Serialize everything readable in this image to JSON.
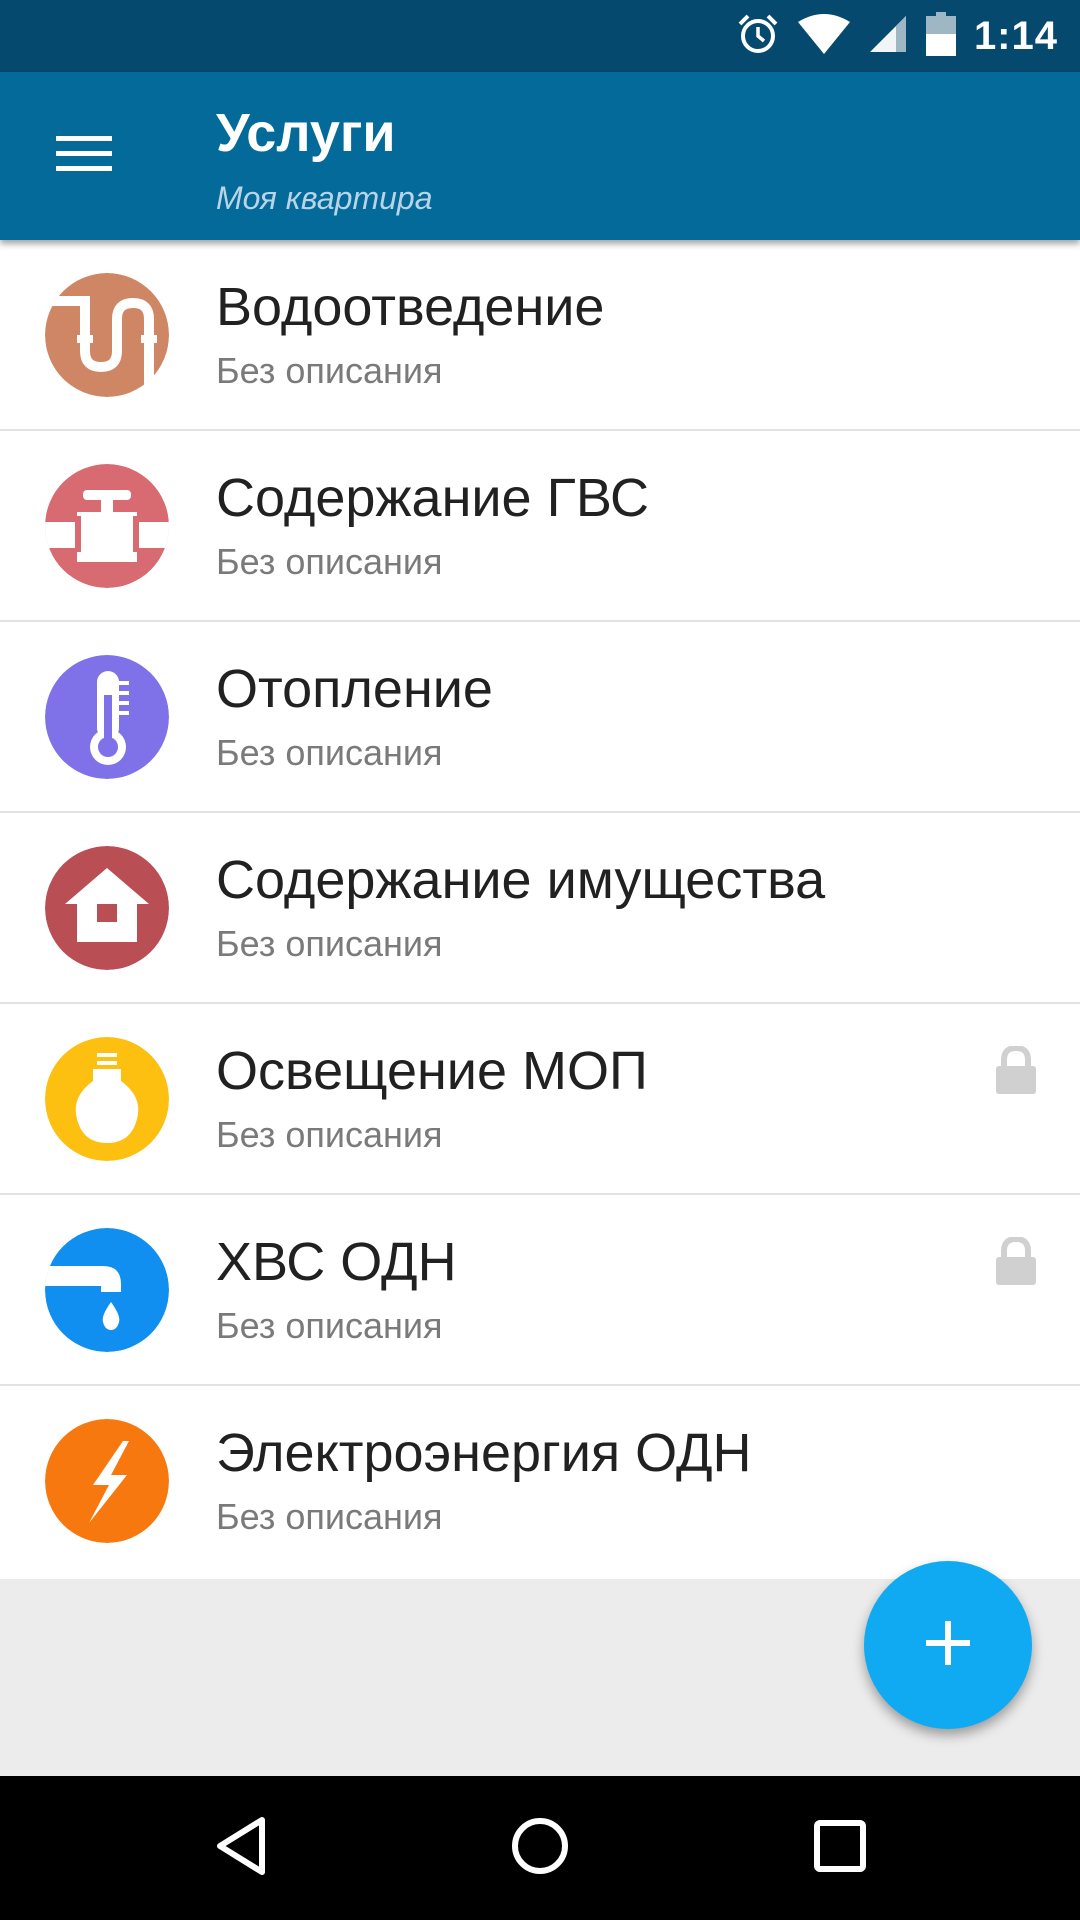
{
  "status_bar": {
    "time": "1:14",
    "icons": [
      "alarm-icon",
      "wifi-icon",
      "signal-icon",
      "battery-icon"
    ]
  },
  "app_bar": {
    "menu_icon": "menu-icon",
    "title": "Услуги",
    "subtitle": "Моя квартира"
  },
  "services": [
    {
      "title": "Водоотведение",
      "description": "Без описания",
      "icon": "drain-pipe-icon",
      "color": "#cf8664",
      "locked": false
    },
    {
      "title": "Содержание ГВС",
      "description": "Без описания",
      "icon": "valve-icon",
      "color": "#d86a71",
      "locked": false
    },
    {
      "title": "Отопление",
      "description": "Без описания",
      "icon": "thermometer-icon",
      "color": "#7f72e8",
      "locked": false
    },
    {
      "title": "Содержание имущества",
      "description": "Без описания",
      "icon": "house-icon",
      "color": "#b94e55",
      "locked": false
    },
    {
      "title": "Освещение МОП",
      "description": "Без описания",
      "icon": "lightbulb-icon",
      "color": "#fdbf10",
      "locked": true
    },
    {
      "title": "ХВС ОДН",
      "description": "Без описания",
      "icon": "faucet-icon",
      "color": "#108ff0",
      "locked": true
    },
    {
      "title": "Электроэнергия ОДН",
      "description": "Без описания",
      "icon": "lightning-icon",
      "color": "#f87810",
      "locked": false
    }
  ],
  "fab": {
    "icon": "plus-icon",
    "color": "#10aaf3"
  },
  "nav_bar": {
    "icons": [
      "back-icon",
      "home-icon",
      "recents-icon"
    ]
  },
  "colors": {
    "status_bar": "#06496e",
    "app_bar": "#036a99",
    "background": "#ececec"
  }
}
